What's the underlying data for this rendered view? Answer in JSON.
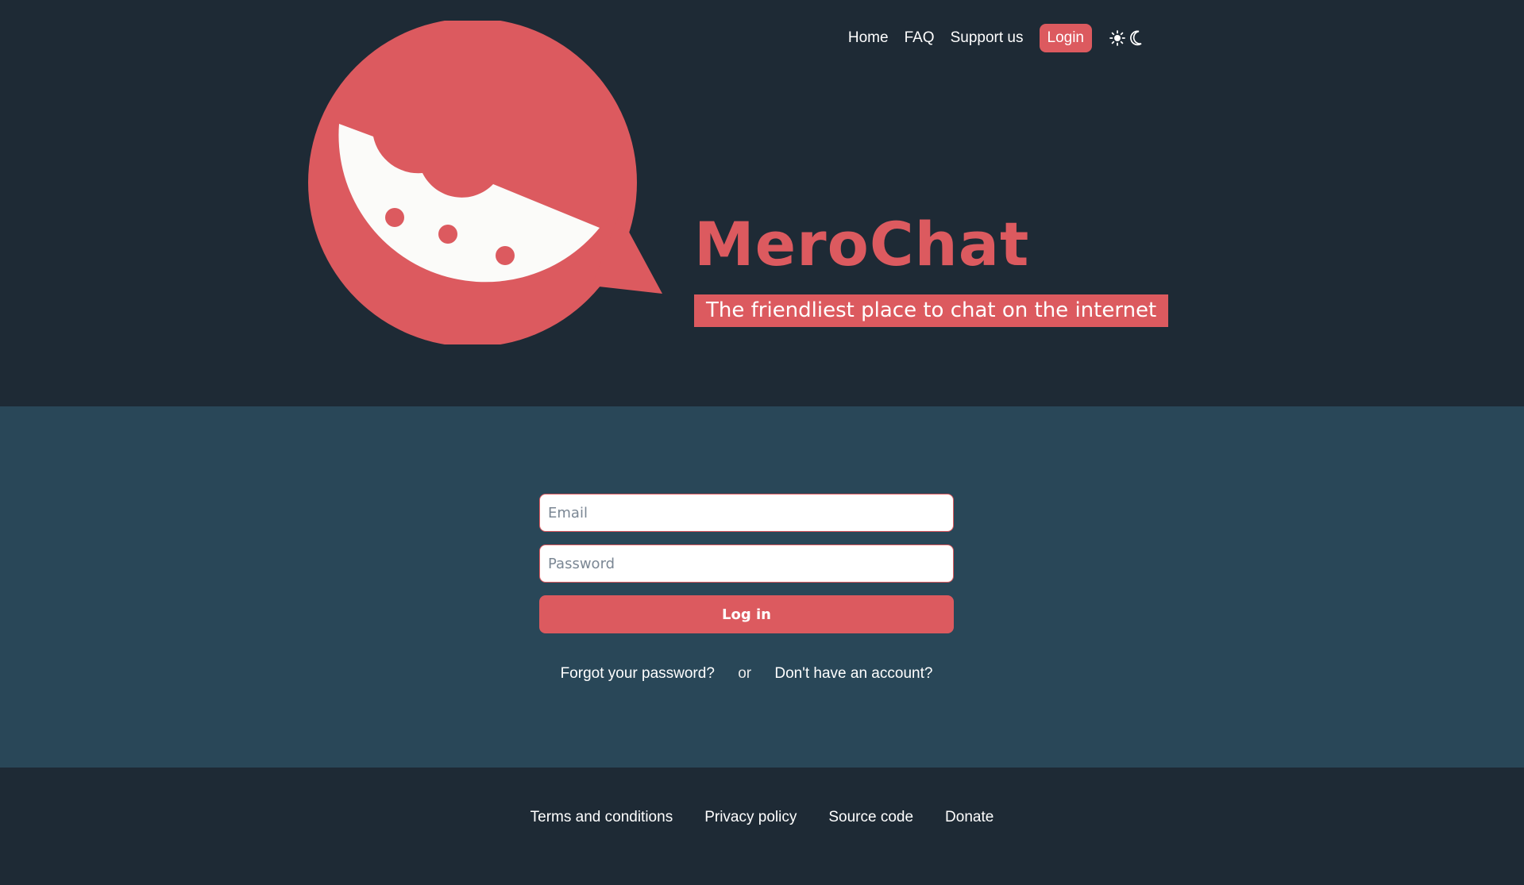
{
  "nav": {
    "items": [
      {
        "label": "Home"
      },
      {
        "label": "FAQ"
      },
      {
        "label": "Support us"
      }
    ],
    "login_label": "Login",
    "theme_icons": [
      "sun-icon",
      "moon-icon"
    ]
  },
  "brand": {
    "title": "MeroChat",
    "tagline": "The friendliest place to chat on the internet"
  },
  "login_form": {
    "email_placeholder": "Email",
    "email_value": "",
    "password_placeholder": "Password",
    "password_value": "",
    "submit_label": "Log in",
    "forgot_label": "Forgot your password?",
    "separator": "or",
    "signup_label": "Don't have an account?"
  },
  "footer": {
    "links": [
      {
        "label": "Terms and conditions"
      },
      {
        "label": "Privacy policy"
      },
      {
        "label": "Source code"
      },
      {
        "label": "Donate"
      }
    ]
  },
  "colors": {
    "accent": "#dc5a5f",
    "header_bg": "#1e2a35",
    "main_bg": "#294758",
    "logo_inner": "#fbfbf9"
  }
}
